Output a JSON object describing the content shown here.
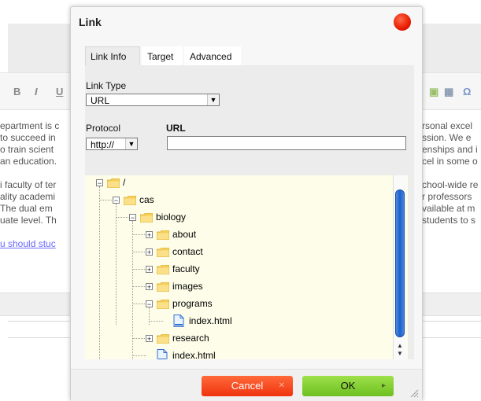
{
  "background": {
    "toolbar": [
      "B",
      "I",
      "U"
    ],
    "text_left": [
      "epartment is c",
      "to succeed in",
      "o train scient",
      "an education.",
      "",
      "i faculty of ter",
      "ality academi",
      " The dual em",
      "uate level. Th",
      "",
      "u should stuc"
    ],
    "text_right": [
      "rsonal excel",
      "ssion. We e",
      "enships and i",
      "cel in some o",
      "",
      "chool-wide re",
      "r professors",
      "vailable at m",
      " students to s"
    ]
  },
  "dialog": {
    "title": "Link",
    "tabs": [
      {
        "label": "Link Info",
        "active": true
      },
      {
        "label": "Target",
        "active": false
      },
      {
        "label": "Advanced",
        "active": false
      }
    ],
    "link_type_label": "Link Type",
    "link_type_value": "URL",
    "protocol_label": "Protocol",
    "protocol_value": "http://",
    "url_label": "URL",
    "url_value": "",
    "tree": [
      {
        "label": "/",
        "depth": 0,
        "type": "folder",
        "expander": "minus"
      },
      {
        "label": "cas",
        "depth": 1,
        "type": "folder",
        "expander": "minus"
      },
      {
        "label": "biology",
        "depth": 2,
        "type": "folder",
        "expander": "minus"
      },
      {
        "label": "about",
        "depth": 3,
        "type": "folder",
        "expander": "plus"
      },
      {
        "label": "contact",
        "depth": 3,
        "type": "folder",
        "expander": "plus"
      },
      {
        "label": "faculty",
        "depth": 3,
        "type": "folder",
        "expander": "plus"
      },
      {
        "label": "images",
        "depth": 3,
        "type": "folder",
        "expander": "plus"
      },
      {
        "label": "programs",
        "depth": 3,
        "type": "folder",
        "expander": "minus"
      },
      {
        "label": "index.html",
        "depth": 4,
        "type": "file",
        "expander": "none"
      },
      {
        "label": "research",
        "depth": 3,
        "type": "folder",
        "expander": "plus"
      },
      {
        "label": "index.html",
        "depth": 3,
        "type": "file",
        "expander": "none"
      }
    ],
    "cancel_label": "Cancel",
    "ok_label": "OK"
  },
  "colors": {
    "close": "#e81c00",
    "cancel": "#f0330f",
    "ok": "#6dc021",
    "tree_bg": "#fdfde9",
    "scroll_thumb": "#1d5fd0"
  },
  "icons": {
    "close": "close-icon",
    "folder": "folder-icon",
    "file": "file-icon",
    "select_arrow": "chevron-down-icon",
    "resize": "resize-grip-icon"
  }
}
